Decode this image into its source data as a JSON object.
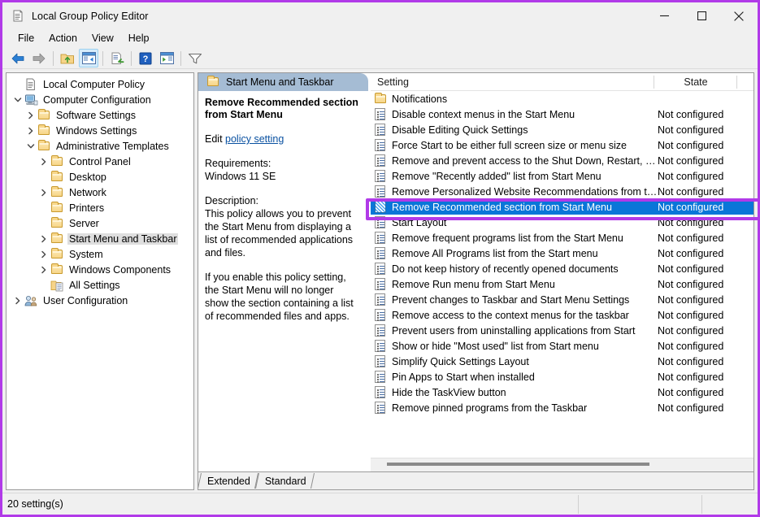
{
  "window": {
    "title": "Local Group Policy Editor",
    "icon": "policy-document-icon",
    "minimize_label": "—",
    "maximize_label": "□",
    "close_label": "✕"
  },
  "menu": {
    "items": [
      {
        "label": "File"
      },
      {
        "label": "Action"
      },
      {
        "label": "View"
      },
      {
        "label": "Help"
      }
    ]
  },
  "toolbar": {
    "buttons": [
      {
        "name": "back-icon",
        "label": "Back"
      },
      {
        "name": "forward-icon",
        "label": "Forward"
      },
      {
        "name": "up-one-level-icon",
        "label": "Up One Level"
      },
      {
        "name": "show-hide-console-tree-icon",
        "label": "Show/Hide Console Tree",
        "active": true
      },
      {
        "name": "properties-icon",
        "label": "Properties"
      },
      {
        "name": "help-icon",
        "label": "Help"
      },
      {
        "name": "show-hide-action-pane-icon",
        "label": "Show/Hide Action Pane"
      },
      {
        "name": "filter-icon",
        "label": "Filter"
      }
    ]
  },
  "tree": {
    "nodes": [
      {
        "label": "Local Computer Policy",
        "indent": 0,
        "chevron": "none",
        "icon": "policy-document-icon",
        "selected": false
      },
      {
        "label": "Computer Configuration",
        "indent": 0,
        "chevron": "down",
        "icon": "computer-icon",
        "selected": false
      },
      {
        "label": "Software Settings",
        "indent": 1,
        "chevron": "right",
        "icon": "folder-icon",
        "selected": false
      },
      {
        "label": "Windows Settings",
        "indent": 1,
        "chevron": "right",
        "icon": "folder-icon",
        "selected": false
      },
      {
        "label": "Administrative Templates",
        "indent": 1,
        "chevron": "down",
        "icon": "folder-icon",
        "selected": false
      },
      {
        "label": "Control Panel",
        "indent": 2,
        "chevron": "right",
        "icon": "folder-icon",
        "selected": false
      },
      {
        "label": "Desktop",
        "indent": 2,
        "chevron": "none",
        "icon": "folder-icon",
        "selected": false
      },
      {
        "label": "Network",
        "indent": 2,
        "chevron": "right",
        "icon": "folder-icon",
        "selected": false
      },
      {
        "label": "Printers",
        "indent": 2,
        "chevron": "none",
        "icon": "folder-icon",
        "selected": false
      },
      {
        "label": "Server",
        "indent": 2,
        "chevron": "none",
        "icon": "folder-icon",
        "selected": false
      },
      {
        "label": "Start Menu and Taskbar",
        "indent": 2,
        "chevron": "right",
        "icon": "folder-icon",
        "selected": true
      },
      {
        "label": "System",
        "indent": 2,
        "chevron": "right",
        "icon": "folder-icon",
        "selected": false
      },
      {
        "label": "Windows Components",
        "indent": 2,
        "chevron": "right",
        "icon": "folder-icon",
        "selected": false
      },
      {
        "label": "All Settings",
        "indent": 2,
        "chevron": "none",
        "icon": "all-settings-icon",
        "selected": false
      },
      {
        "label": "User Configuration",
        "indent": 0,
        "chevron": "right",
        "icon": "user-icon",
        "selected": false
      }
    ]
  },
  "content_header": {
    "title": "Start Menu and Taskbar",
    "icon": "folder-icon"
  },
  "detail": {
    "policy_title": "Remove Recommended section from Start Menu",
    "edit_prefix": "Edit",
    "edit_link": "policy setting",
    "requirements_label": "Requirements:",
    "requirements_value": "Windows 11 SE",
    "description_label": "Description:",
    "description_paragraph_1": "This policy allows you to prevent the Start Menu from displaying a list of recommended applications and files.",
    "description_paragraph_2": "If you enable this policy setting, the Start Menu will no longer show the section containing a list of recommended files and apps."
  },
  "listview": {
    "columns": [
      {
        "label": "Setting",
        "align": "left"
      },
      {
        "label": "State",
        "align": "center"
      },
      {
        "label": "",
        "align": "left"
      }
    ],
    "rows": [
      {
        "setting": "Notifications",
        "state": "",
        "icon": "folder-icon",
        "selected": false
      },
      {
        "setting": "Disable context menus in the Start Menu",
        "state": "Not configured",
        "icon": "policy-icon",
        "selected": false
      },
      {
        "setting": "Disable Editing Quick Settings",
        "state": "Not configured",
        "icon": "policy-icon",
        "selected": false
      },
      {
        "setting": "Force Start to be either full screen size or menu size",
        "state": "Not configured",
        "icon": "policy-icon",
        "selected": false
      },
      {
        "setting": "Remove and prevent access to the Shut Down, Restart, Sleep...",
        "state": "Not configured",
        "icon": "policy-icon",
        "selected": false
      },
      {
        "setting": "Remove \"Recently added\" list from Start Menu",
        "state": "Not configured",
        "icon": "policy-icon",
        "selected": false
      },
      {
        "setting": "Remove Personalized Website Recommendations from the ...",
        "state": "Not configured",
        "icon": "policy-icon",
        "selected": false
      },
      {
        "setting": "Remove Recommended section from Start Menu",
        "state": "Not configured",
        "icon": "policy-icon-selected",
        "selected": true
      },
      {
        "setting": "Start Layout",
        "state": "Not configured",
        "icon": "policy-icon",
        "selected": false
      },
      {
        "setting": "Remove frequent programs list from the Start Menu",
        "state": "Not configured",
        "icon": "policy-icon",
        "selected": false
      },
      {
        "setting": "Remove All Programs list from the Start menu",
        "state": "Not configured",
        "icon": "policy-icon",
        "selected": false
      },
      {
        "setting": "Do not keep history of recently opened documents",
        "state": "Not configured",
        "icon": "policy-icon",
        "selected": false
      },
      {
        "setting": "Remove Run menu from Start Menu",
        "state": "Not configured",
        "icon": "policy-icon",
        "selected": false
      },
      {
        "setting": "Prevent changes to Taskbar and Start Menu Settings",
        "state": "Not configured",
        "icon": "policy-icon",
        "selected": false
      },
      {
        "setting": "Remove access to the context menus for the taskbar",
        "state": "Not configured",
        "icon": "policy-icon",
        "selected": false
      },
      {
        "setting": "Prevent users from uninstalling applications from Start",
        "state": "Not configured",
        "icon": "policy-icon",
        "selected": false
      },
      {
        "setting": "Show or hide \"Most used\" list from Start menu",
        "state": "Not configured",
        "icon": "policy-icon",
        "selected": false
      },
      {
        "setting": "Simplify Quick Settings Layout",
        "state": "Not configured",
        "icon": "policy-icon",
        "selected": false
      },
      {
        "setting": "Pin Apps to Start when installed",
        "state": "Not configured",
        "icon": "policy-icon",
        "selected": false
      },
      {
        "setting": "Hide the TaskView button",
        "state": "Not configured",
        "icon": "policy-icon",
        "selected": false
      },
      {
        "setting": "Remove pinned programs from the Taskbar",
        "state": "Not configured",
        "icon": "policy-icon",
        "selected": false
      }
    ]
  },
  "tabs": [
    {
      "label": "Extended",
      "selected": false
    },
    {
      "label": "Standard",
      "selected": true
    }
  ],
  "statusbar": {
    "text": "20 setting(s)"
  },
  "annotation": {
    "color": "#b13ae8",
    "target": "Remove Recommended section from Start Menu"
  }
}
